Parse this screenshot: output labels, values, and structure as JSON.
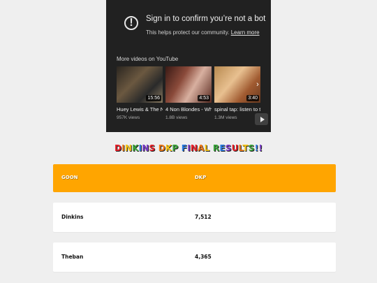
{
  "player": {
    "notice_title": "Sign in to confirm you’re not a bot",
    "notice_sub": "This helps protect our community.",
    "learn_more": "Learn more",
    "more_heading": "More videos on YouTube",
    "videos": [
      {
        "title": "Huey Lewis & The N...",
        "views": "957K views",
        "duration": "15:56"
      },
      {
        "title": "4 Non Blondes - Wh...",
        "views": "1.8B views",
        "duration": "4:53"
      },
      {
        "title": "spinal tap: listen to t...",
        "views": "1.3M views",
        "duration": "3:40"
      }
    ],
    "next_icon": "chevron-right-icon",
    "logo_icon": "youtube-play-icon"
  },
  "heading": {
    "chars": [
      {
        "c": "D",
        "color": "#e8202a"
      },
      {
        "c": "I",
        "color": "#f07b1a"
      },
      {
        "c": "N",
        "color": "#f5c518"
      },
      {
        "c": "K",
        "color": "#3aa63a"
      },
      {
        "c": "I",
        "color": "#2a7be0"
      },
      {
        "c": "N",
        "color": "#7a3cc8"
      },
      {
        "c": "S",
        "color": "#e8202a"
      },
      {
        "c": " ",
        "color": "#000000"
      },
      {
        "c": "D",
        "color": "#f07b1a"
      },
      {
        "c": "K",
        "color": "#f5c518"
      },
      {
        "c": "P",
        "color": "#3aa63a"
      },
      {
        "c": " ",
        "color": "#000000"
      },
      {
        "c": "F",
        "color": "#2a7be0"
      },
      {
        "c": "I",
        "color": "#7a3cc8"
      },
      {
        "c": "N",
        "color": "#e8202a"
      },
      {
        "c": "A",
        "color": "#f07b1a"
      },
      {
        "c": "L",
        "color": "#f5c518"
      },
      {
        "c": " ",
        "color": "#000000"
      },
      {
        "c": "R",
        "color": "#3aa63a"
      },
      {
        "c": "E",
        "color": "#2a7be0"
      },
      {
        "c": "S",
        "color": "#7a3cc8"
      },
      {
        "c": "U",
        "color": "#e8202a"
      },
      {
        "c": "L",
        "color": "#f07b1a"
      },
      {
        "c": "T",
        "color": "#f5c518"
      },
      {
        "c": "S",
        "color": "#3aa63a"
      },
      {
        "c": "!",
        "color": "#2a7be0"
      },
      {
        "c": "!",
        "color": "#7a3cc8"
      }
    ]
  },
  "table": {
    "headers": {
      "name": "GOON",
      "dkp": "DKP"
    },
    "rows": [
      {
        "name": "Dinkins",
        "dkp": "7,512"
      },
      {
        "name": "Theban",
        "dkp": "4,365"
      }
    ],
    "header_color": "#ffa500"
  }
}
